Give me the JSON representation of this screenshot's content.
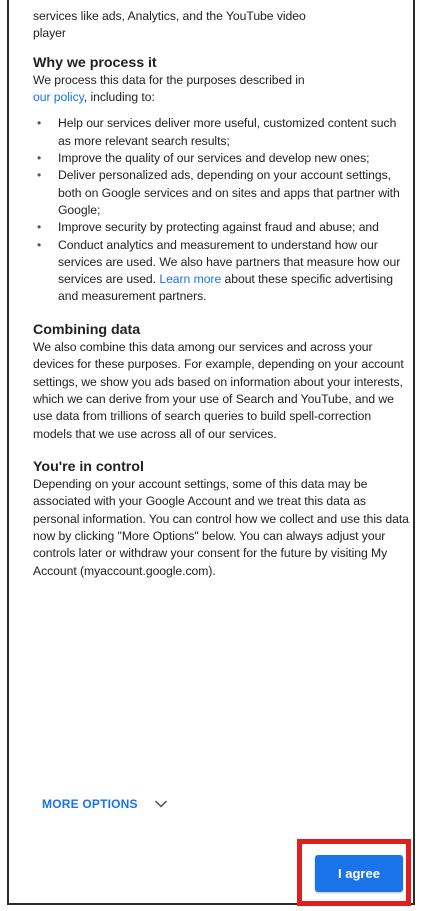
{
  "intro_tail": {
    "line1": "services like ads, Analytics, and the YouTube video",
    "line2": "player"
  },
  "why_section": {
    "heading": "Why we process it",
    "intro_prefix": "We process this data for the purposes described in",
    "policy_link": "our policy",
    "intro_suffix": ", including to:",
    "bullets": [
      {
        "text": "Help our services deliver more useful, customized content such as more relevant search results;"
      },
      {
        "text": "Improve the quality of our services and develop new ones;"
      },
      {
        "text": "Deliver personalized ads, depending on your account settings, both on Google services and on sites and apps that partner with Google;"
      },
      {
        "text": "Improve security by protecting against fraud and abuse; and"
      },
      {
        "text_before_link": "Conduct analytics and measurement to understand how our services are used. We also have partners that measure how our services are used. ",
        "link": "Learn more",
        "text_after_link": " about these specific advertising and measurement partners."
      }
    ]
  },
  "combining_section": {
    "heading": "Combining data",
    "body": "We also combine this data among our services and across your devices for these purposes. For example, depending on your account settings, we show you ads based on information about your interests, which we can derive from your use of Search and YouTube, and we use data from trillions of search queries to build spell-correction models that we use across all of our services."
  },
  "control_section": {
    "heading": "You're in control",
    "body": "Depending on your account settings, some of this data may be associated with your Google Account and we treat this data as personal information. You can control how we collect and use this data now by clicking \"More Options\" below. You can always adjust your controls later or withdraw your consent for the future by visiting My Account (myaccount.google.com)."
  },
  "more_options": {
    "label": "MORE OPTIONS",
    "icon": "chevron-down-icon"
  },
  "agree_button": {
    "label": "I agree"
  },
  "colors": {
    "link": "#1a73e8",
    "button_bg": "#1a73e8",
    "highlight_border": "#e11d1d"
  }
}
